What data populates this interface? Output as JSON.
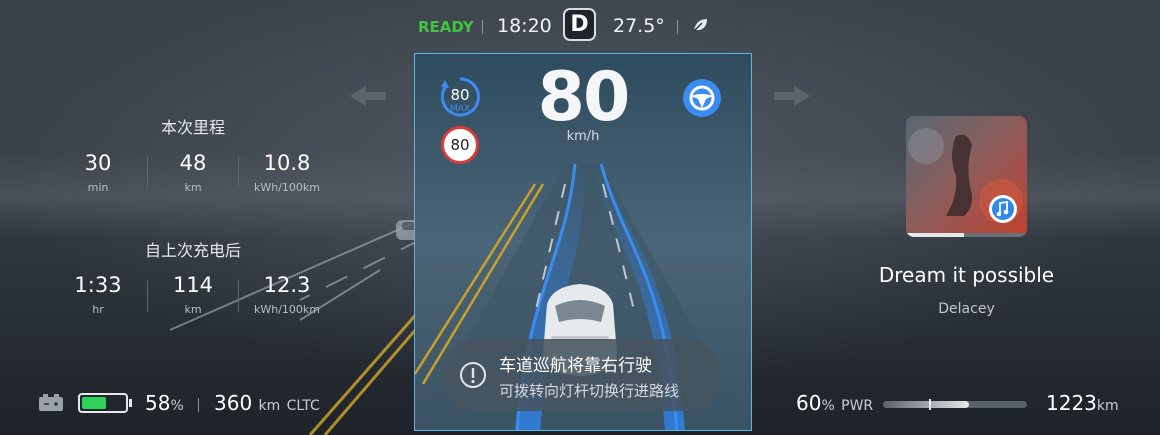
{
  "status_bar": {
    "ready": "READY",
    "time": "18:20",
    "gear": "D",
    "temperature": "27.5°",
    "eco_icon": "leaf-icon"
  },
  "nav_arrows": {
    "left": "arrow-left-icon",
    "right": "arrow-right-icon"
  },
  "trip": {
    "title": "本次里程",
    "duration": {
      "value": "30",
      "unit": "min"
    },
    "distance": {
      "value": "48",
      "unit": "km"
    },
    "consumption": {
      "value": "10.8",
      "unit": "kWh/100km"
    }
  },
  "since_charge": {
    "title": "自上次充电后",
    "duration": {
      "value": "1:33",
      "unit": "hr"
    },
    "distance": {
      "value": "114",
      "unit": "km"
    },
    "consumption": {
      "value": "12.3",
      "unit": "kWh/100km"
    }
  },
  "drive_panel": {
    "speed": "80",
    "speed_unit": "km/h",
    "set_speed": "80",
    "set_speed_label": "MAX",
    "speed_limit": "80",
    "steering_icon": "steering-wheel-icon",
    "toast": {
      "line1": "车道巡航将靠右行驶",
      "line2": "可拨转向灯杆切换行进路线",
      "icon": "info-icon"
    }
  },
  "media": {
    "song": "Dream it possible",
    "artist": "Delacey",
    "app_icon": "music-app-icon",
    "progress": 0.48
  },
  "bottom_left": {
    "battery_percent": "58",
    "percent_sign": "%",
    "battery_level": 0.58,
    "range": "360",
    "range_unit": "km",
    "range_standard": "CLTC"
  },
  "bottom_right": {
    "power_percent": "60",
    "percent_sign": "%",
    "power_label": "PWR",
    "power_level": 0.6,
    "odometer": "1223",
    "odometer_unit": "km"
  },
  "colors": {
    "ready": "#3ec43e",
    "lane_blue": "#2f7fe0",
    "battery_green": "#2fd15a",
    "speed_limit_red": "#d93a3a",
    "panel_border": "#5db4e6"
  }
}
